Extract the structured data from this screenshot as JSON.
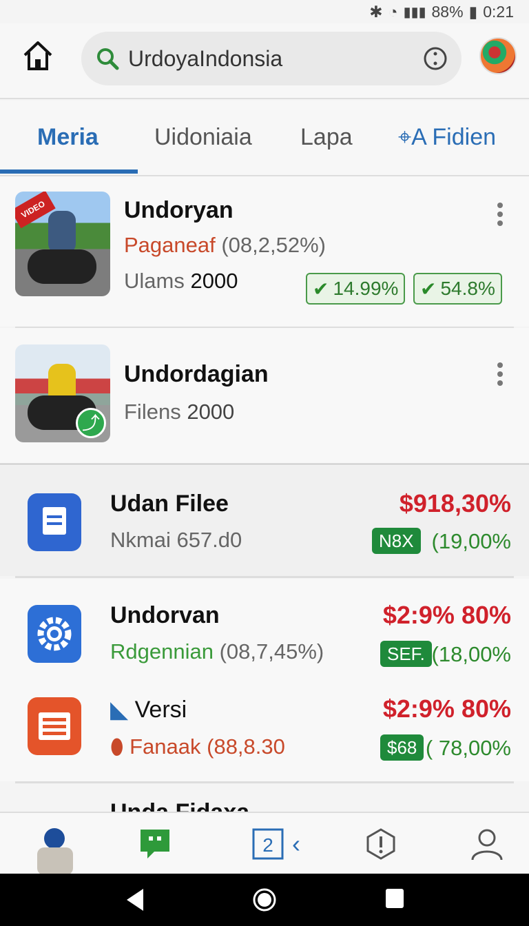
{
  "status": {
    "signal": "▮▮▮",
    "battery": "88%",
    "time": "0:21"
  },
  "search": {
    "text": "UrdoyaIndonsia"
  },
  "tabs": [
    {
      "label": "Meria"
    },
    {
      "label": "Uidoniaia"
    },
    {
      "label": "Lapa"
    },
    {
      "label": "A Fidien"
    }
  ],
  "items": [
    {
      "title": "Undoryan",
      "sub": "Paganeaf",
      "sub_paren": "(08,2,52%)",
      "meta_label": "Ulams",
      "meta_value": "2000",
      "pill1": "14.99%",
      "pill2": "54.8%",
      "thumb_badge": "VIDEO"
    },
    {
      "title": "Undordagian",
      "meta_label": "Filens",
      "meta_value": "2000"
    }
  ],
  "list": [
    {
      "title": "Udan Filee",
      "sub": "Nkmai 657.d0",
      "price": "$918,30%",
      "badge": "N8X",
      "pct": "(19,00%"
    },
    {
      "title": "Undorvan",
      "sub": "Rdgennian",
      "sub_paren": "(08,7,45%)",
      "price": "$2:9% 80%",
      "badge": "SEF.",
      "pct": "(18,00%"
    },
    {
      "title": "Versi",
      "sub": "Fanaak",
      "sub_paren": "(88,8.30",
      "price": "$2:9% 80%",
      "badge": "$68",
      "pct": "( 78,00%"
    }
  ],
  "partial_title": "Unda Fidaxa",
  "colors": {
    "accent": "#2a6db5",
    "price_red": "#d0212b",
    "positive_green": "#1f8a3b"
  }
}
